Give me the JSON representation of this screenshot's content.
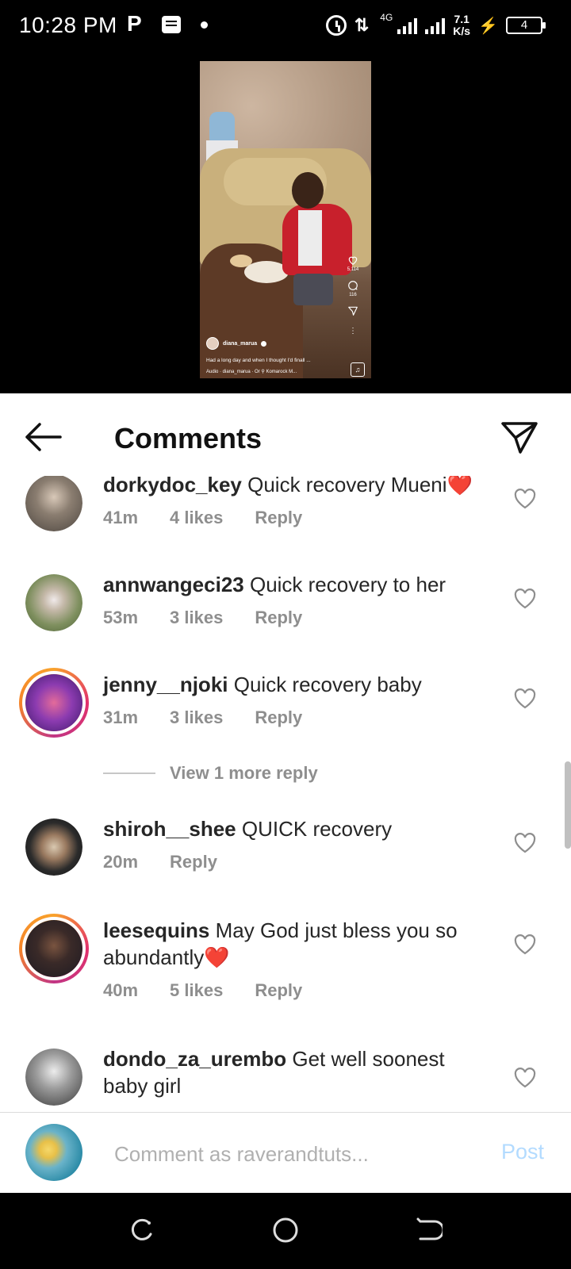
{
  "status_bar": {
    "time": "10:28 PM",
    "p_icon": "P",
    "network": "4G",
    "speed_value": "7.1",
    "speed_unit": "K/s",
    "battery": "4"
  },
  "video": {
    "likes": "5,114",
    "comments": "116",
    "username": "diana_marua",
    "caption": "Had a long day and when I thought I'd finall ...",
    "audio": "Audio · diana_marua · Or",
    "location": "Komarock M..."
  },
  "header": {
    "title": "Comments"
  },
  "comments": [
    {
      "username": "dorkydoc_key",
      "text": "Quick recovery Mueni",
      "emoji": "❤️",
      "time": "41m",
      "likes": "4 likes",
      "reply": "Reply",
      "avatar_color": "#6b6a66",
      "ring": false
    },
    {
      "username": "annwangeci23",
      "text": "Quick recovery to her",
      "emoji": "",
      "time": "53m",
      "likes": "3 likes",
      "reply": "Reply",
      "avatar_color": "#7e8f5e",
      "ring": false
    },
    {
      "username": "jenny__njoki",
      "text": "Quick recovery baby",
      "emoji": "",
      "time": "31m",
      "likes": "3 likes",
      "reply": "Reply",
      "avatar_color": "#6a2b8c",
      "ring": true
    },
    {
      "username": "shiroh__shee",
      "text": "QUICK recovery",
      "emoji": "",
      "time": "20m",
      "likes": "",
      "reply": "Reply",
      "avatar_color": "#2b2b2b",
      "ring": false
    },
    {
      "username": "leesequins",
      "text": "May God just bless you so abundantly",
      "emoji": "❤️",
      "time": "40m",
      "likes": "5 likes",
      "reply": "Reply",
      "avatar_color": "#1d1a22",
      "ring": true
    },
    {
      "username": "dondo_za_urembo",
      "text": "Get well soonest baby girl",
      "emoji": "",
      "time": "",
      "likes": "",
      "reply": "",
      "avatar_color": "#9a9a9a",
      "ring": false
    }
  ],
  "view_more": "View 1 more reply",
  "input": {
    "placeholder": "Comment as raverandtuts...",
    "post_label": "Post"
  },
  "colors": {
    "meta_gray": "#8e8e8e",
    "post_blue_disabled": "#b3dbff",
    "heart_red": "#e0242d"
  }
}
